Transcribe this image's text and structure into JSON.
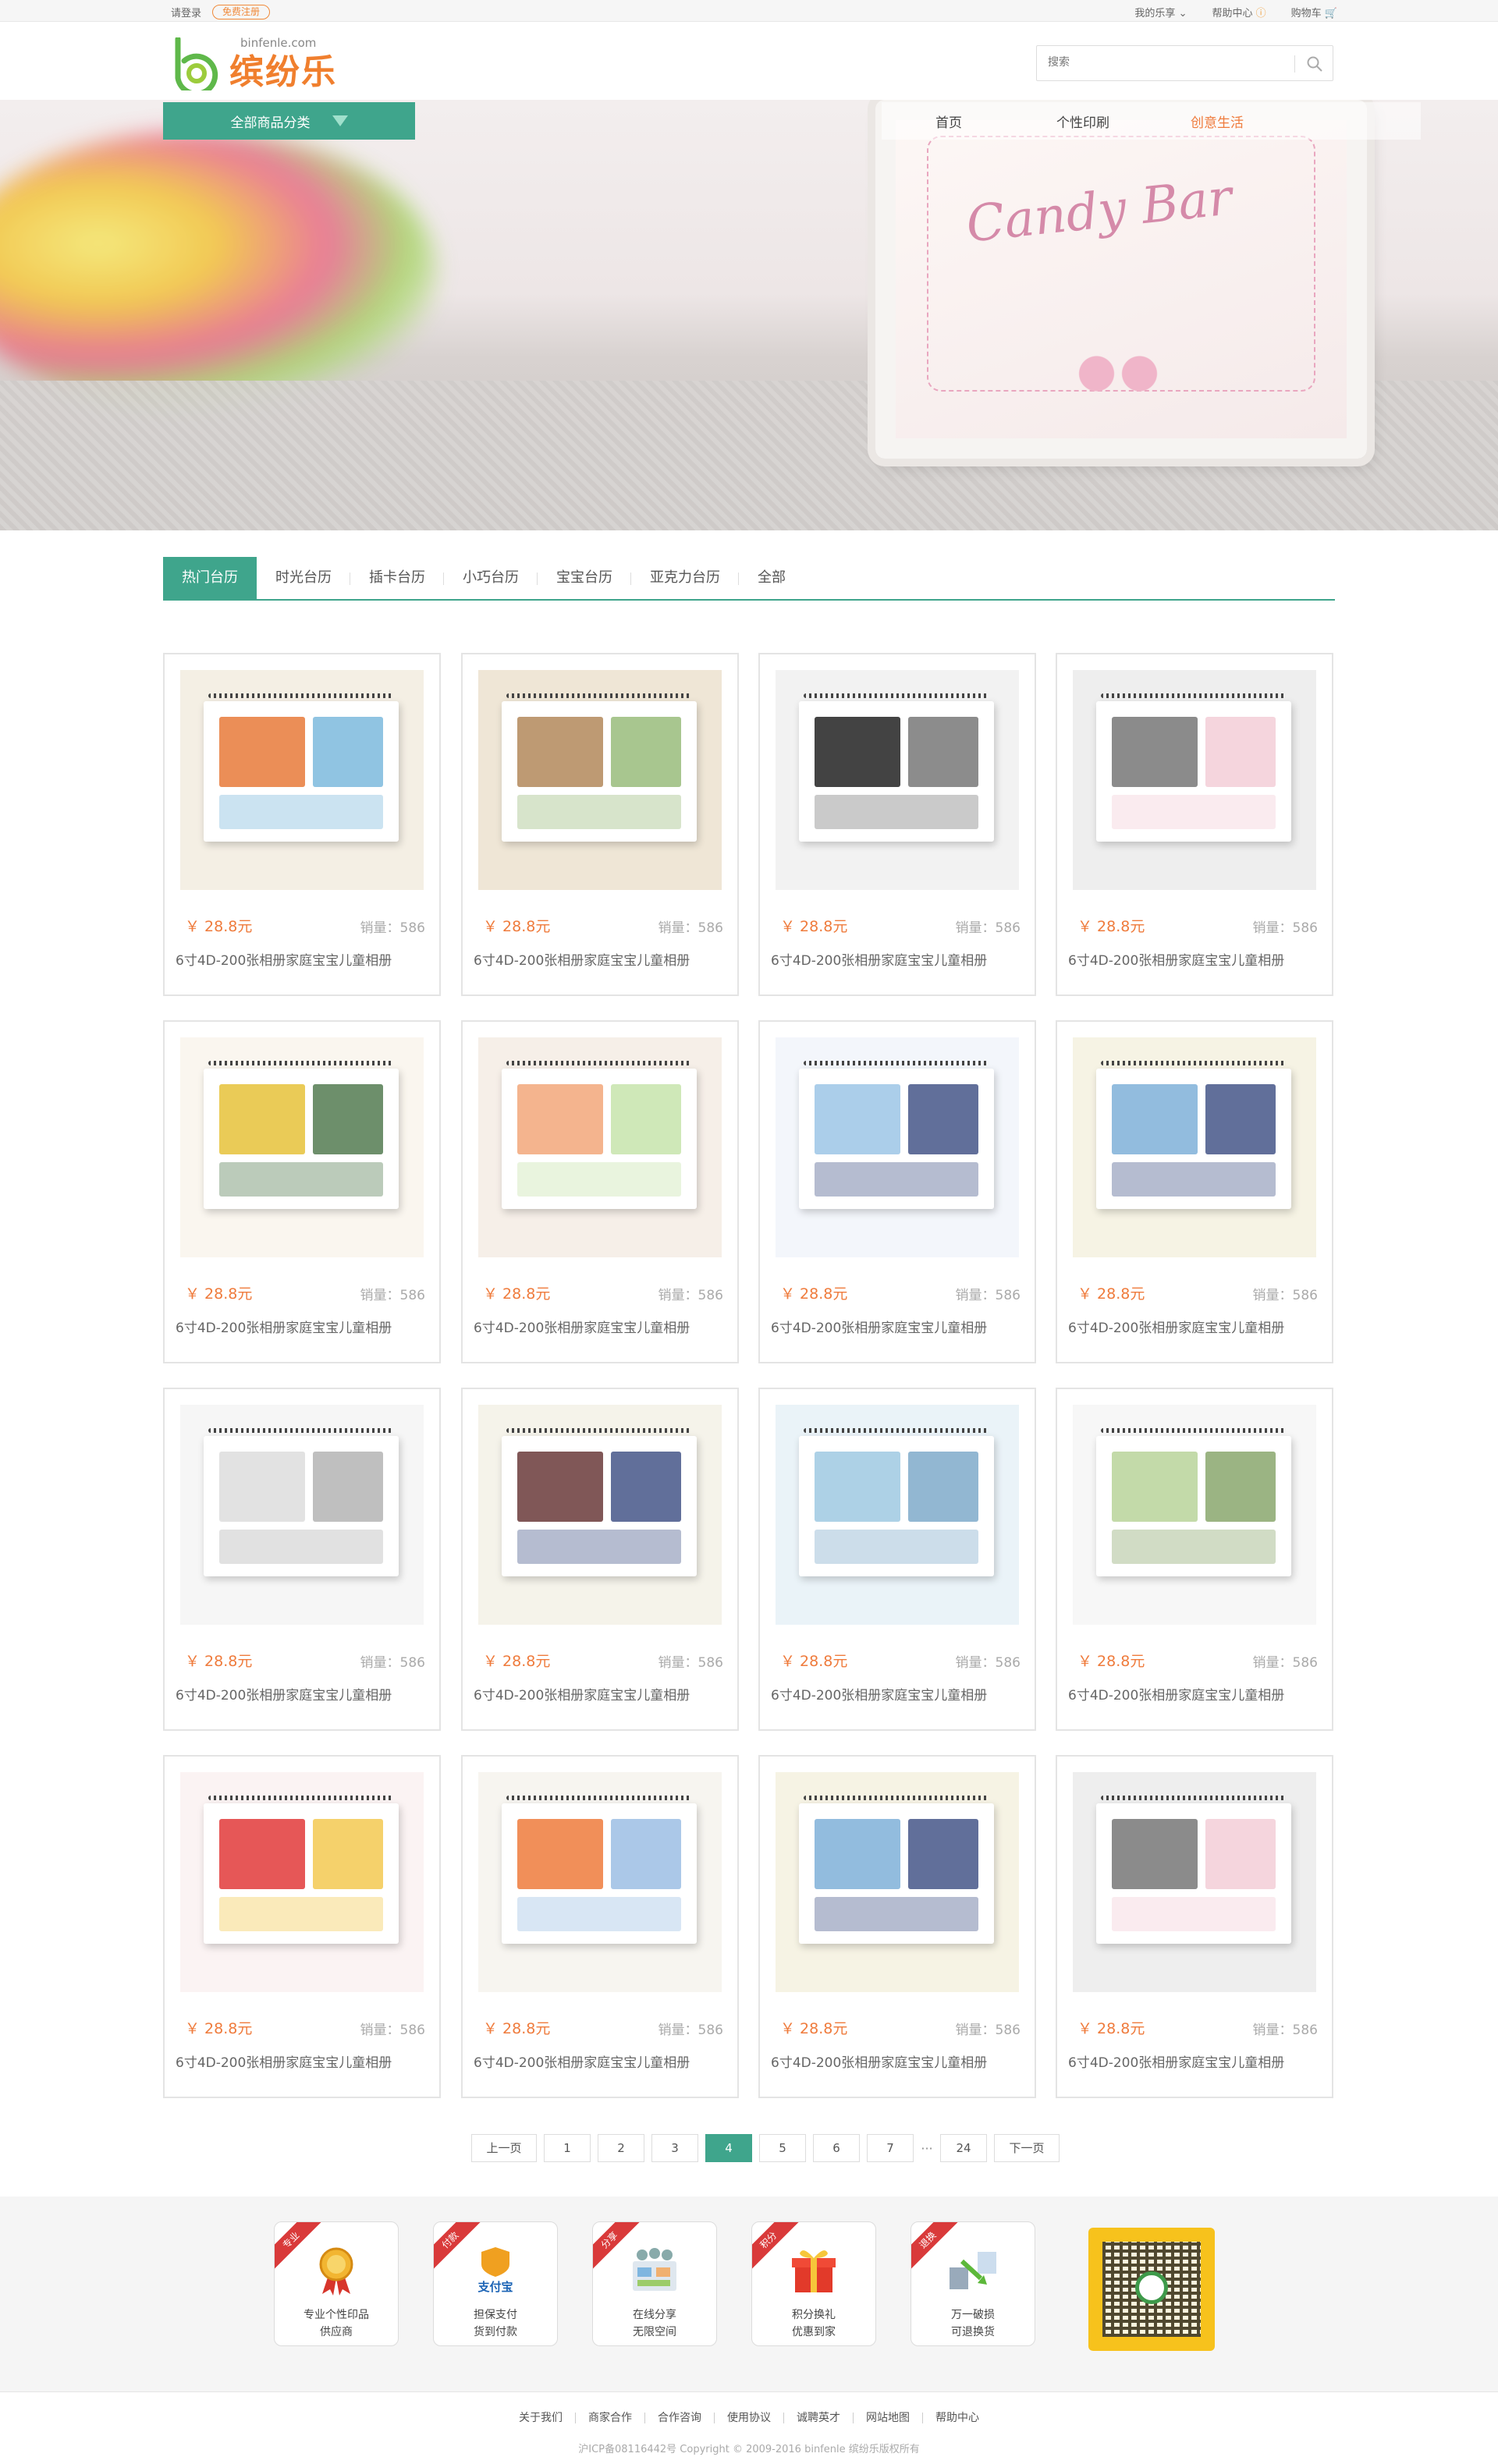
{
  "topbar": {
    "login": "请登录",
    "register": "免费注册",
    "my": "我的乐享",
    "help": "帮助中心",
    "cart": "购物车"
  },
  "logo": {
    "brand": "缤纷乐",
    "domain": "binfenle.com"
  },
  "search": {
    "placeholder": "搜索"
  },
  "nav": {
    "category_label": "全部商品分类",
    "items": [
      {
        "label": "首页"
      },
      {
        "label": "个性印刷"
      },
      {
        "label": "创意生活"
      }
    ]
  },
  "banner": {
    "script_text": "Candy Bar"
  },
  "tabs": [
    {
      "label": "热门台历"
    },
    {
      "label": "时光台历"
    },
    {
      "label": "插卡台历"
    },
    {
      "label": "小巧台历"
    },
    {
      "label": "宝宝台历"
    },
    {
      "label": "亚克力台历"
    },
    {
      "label": "全部"
    }
  ],
  "products": [
    {
      "price": "￥ 28.8元",
      "sales": "销量：586",
      "name": "6寸4D-200张相册家庭宝宝儿童相册"
    },
    {
      "price": "￥ 28.8元",
      "sales": "销量：586",
      "name": "6寸4D-200张相册家庭宝宝儿童相册"
    },
    {
      "price": "￥ 28.8元",
      "sales": "销量：586",
      "name": "6寸4D-200张相册家庭宝宝儿童相册"
    },
    {
      "price": "￥ 28.8元",
      "sales": "销量：586",
      "name": "6寸4D-200张相册家庭宝宝儿童相册"
    },
    {
      "price": "￥ 28.8元",
      "sales": "销量：586",
      "name": "6寸4D-200张相册家庭宝宝儿童相册"
    },
    {
      "price": "￥ 28.8元",
      "sales": "销量：586",
      "name": "6寸4D-200张相册家庭宝宝儿童相册"
    },
    {
      "price": "￥ 28.8元",
      "sales": "销量：586",
      "name": "6寸4D-200张相册家庭宝宝儿童相册"
    },
    {
      "price": "￥ 28.8元",
      "sales": "销量：586",
      "name": "6寸4D-200张相册家庭宝宝儿童相册"
    },
    {
      "price": "￥ 28.8元",
      "sales": "销量：586",
      "name": "6寸4D-200张相册家庭宝宝儿童相册"
    },
    {
      "price": "￥ 28.8元",
      "sales": "销量：586",
      "name": "6寸4D-200张相册家庭宝宝儿童相册"
    },
    {
      "price": "￥ 28.8元",
      "sales": "销量：586",
      "name": "6寸4D-200张相册家庭宝宝儿童相册"
    },
    {
      "price": "￥ 28.8元",
      "sales": "销量：586",
      "name": "6寸4D-200张相册家庭宝宝儿童相册"
    },
    {
      "price": "￥ 28.8元",
      "sales": "销量：586",
      "name": "6寸4D-200张相册家庭宝宝儿童相册"
    },
    {
      "price": "￥ 28.8元",
      "sales": "销量：586",
      "name": "6寸4D-200张相册家庭宝宝儿童相册"
    },
    {
      "price": "￥ 28.8元",
      "sales": "销量：586",
      "name": "6寸4D-200张相册家庭宝宝儿童相册"
    },
    {
      "price": "￥ 28.8元",
      "sales": "销量：586",
      "name": "6寸4D-200张相册家庭宝宝儿童相册"
    }
  ],
  "pager": {
    "prev": "上一页",
    "next": "下一页",
    "pages": [
      "1",
      "2",
      "3",
      "4",
      "5",
      "6",
      "7"
    ],
    "current": "4",
    "ellipsis": "···",
    "last": "24"
  },
  "features": [
    {
      "ribbon": "专业",
      "line1": "专业个性印品",
      "line2": "供应商",
      "icon": "medal-icon"
    },
    {
      "ribbon": "付款",
      "line1": "担保支付",
      "line2": "货到付款",
      "icon": "alipay-icon"
    },
    {
      "ribbon": "分享",
      "line1": "在线分享",
      "line2": "无限空间",
      "icon": "share-icon"
    },
    {
      "ribbon": "积分",
      "line1": "积分换礼",
      "line2": "优惠到家",
      "icon": "gift-icon"
    },
    {
      "ribbon": "退换",
      "line1": "万一破损",
      "line2": "可退换货",
      "icon": "exchange-icon"
    }
  ],
  "footer": {
    "links": [
      "关于我们",
      "商家合作",
      "合作咨询",
      "使用协议",
      "诚聘英才",
      "网站地图",
      "帮助中心"
    ],
    "copyright": "沪ICP备08116442号 Copyright © 2009-2016 binfenle 缤纷乐版权所有"
  },
  "colors": {
    "accent": "#3fa58c",
    "orange": "#ef7b3c"
  }
}
